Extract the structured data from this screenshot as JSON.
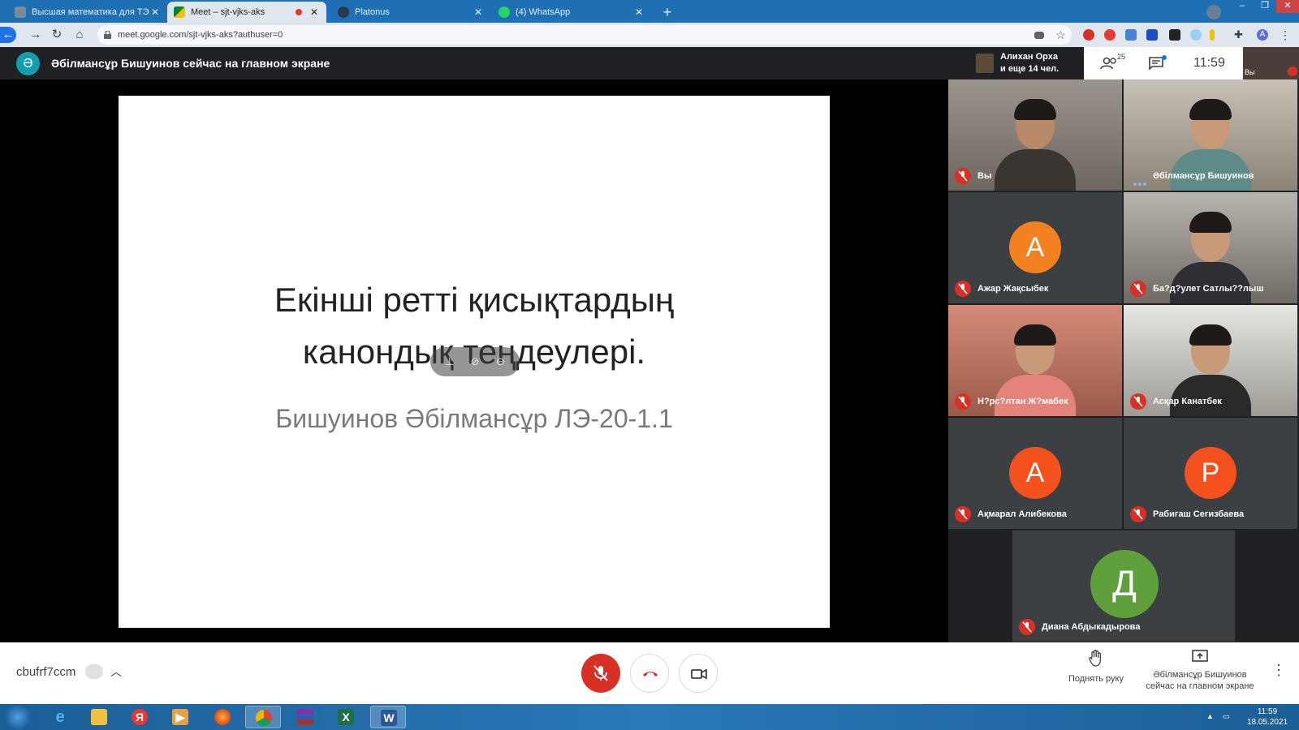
{
  "browser": {
    "tabs": [
      {
        "label": "Высшая математика для ТЭ",
        "active": false,
        "icon": "user-icon"
      },
      {
        "label": "Meet – sjt-vjks-aks",
        "active": true,
        "icon": "google-meet-icon",
        "recording": true
      },
      {
        "label": "Platonus",
        "active": false,
        "icon": "platonus-icon"
      },
      {
        "label": "(4) WhatsApp",
        "active": false,
        "icon": "whatsapp-icon"
      }
    ],
    "url": "meet.google.com/sjt-vjks-aks?authuser=0",
    "profile_initial": "A"
  },
  "meet": {
    "presenter_initial": "Ә",
    "presenting_text": "Әбілмансұр Бишуинов сейчас на главном экране",
    "others_text_line1": "Алихан Орха",
    "others_text_line2": "и еще 14 чел.",
    "participants_count": "25",
    "time": "11:59",
    "self_mini_label": "Вы"
  },
  "slide": {
    "title": "Екінші ретті қисықтардың\nканондық теңдеулері.",
    "subtitle": "Бишуинов Әбілмансұр ЛЭ-20-1.1"
  },
  "participants": [
    {
      "name": "Вы",
      "type": "camera",
      "style": "cam",
      "muted": true
    },
    {
      "name": "Әбілмансұр Бишуинов",
      "type": "camera",
      "style": "cam2",
      "muted": false,
      "speaking": true
    },
    {
      "name": "Ажар Жақсыбек",
      "type": "avatar",
      "initial": "А",
      "color": "#f4811f",
      "muted": true
    },
    {
      "name": "Ба?д?улет Сатлы??лыш",
      "type": "camera",
      "style": "cam5",
      "muted": true
    },
    {
      "name": "Н?рс?лтан Ж?мабек",
      "type": "camera",
      "style": "cam3",
      "muted": true
    },
    {
      "name": "Асқар Канатбек",
      "type": "camera",
      "style": "cam4",
      "muted": true
    },
    {
      "name": "Ақмарал Алибекова",
      "type": "avatar",
      "initial": "А",
      "color": "#f4511e",
      "muted": true
    },
    {
      "name": "Рабигаш Сегизбаева",
      "type": "avatar",
      "initial": "Р",
      "color": "#f4511e",
      "muted": true
    },
    {
      "name": "Диана Абдыкадырова",
      "type": "avatar",
      "initial": "Д",
      "color": "#5fa03c",
      "muted": true
    }
  ],
  "bottom": {
    "meeting_code": "cbufrf7ccm",
    "raise_hand": "Поднять руку",
    "presenting_label_line1": "Әбілмансұр Бишуинов",
    "presenting_label_line2": "сейчас на главном экране"
  },
  "taskbar": {
    "time": "11:59",
    "date": "18.05.2021",
    "apps": [
      "internet-explorer-icon",
      "file-explorer-icon",
      "yandex-icon",
      "media-player-icon",
      "firefox-icon",
      "chrome-icon",
      "winrar-icon",
      "excel-icon",
      "word-icon"
    ]
  },
  "colors": {
    "accent": "#1a73e8",
    "danger": "#d93025",
    "meet_dark": "#202124",
    "taskbar": "#2a78b8"
  }
}
